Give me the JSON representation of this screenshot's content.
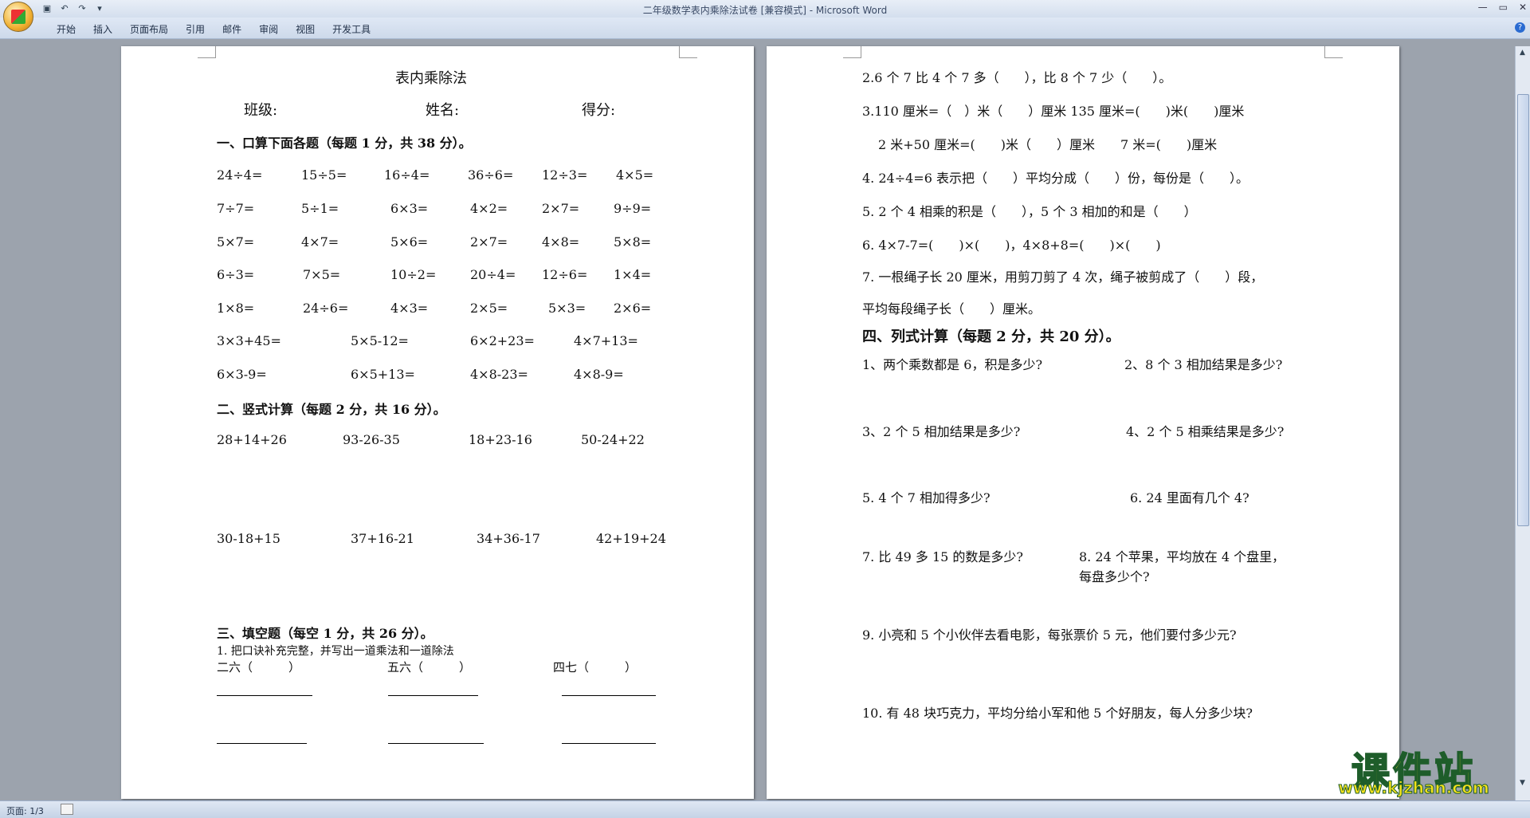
{
  "window": {
    "title": "二年级数学表内乘除法试卷 [兼容模式] - Microsoft Word",
    "tabs": [
      "开始",
      "插入",
      "页面布局",
      "引用",
      "邮件",
      "审阅",
      "视图",
      "开发工具"
    ]
  },
  "status": {
    "page": "页面: 1/3"
  },
  "watermark": {
    "brand": "课件站",
    "url": "www.kjzhan.com"
  },
  "page1": {
    "title": "表内乘除法",
    "class_label": "班级:",
    "name_label": "姓名:",
    "score_label": "得分:",
    "sec1": "一、口算下面各题（每题 1 分，共 38 分）。",
    "oral_rows": [
      [
        "24÷4=",
        "15÷5=",
        "16÷4=",
        "36÷6=",
        "12÷3=",
        "4×5="
      ],
      [
        "7÷7=",
        "5÷1=",
        "6×3=",
        "4×2=",
        "2×7=",
        "9÷9="
      ],
      [
        "5×7=",
        "4×7=",
        "5×6=",
        "2×7=",
        "4×8=",
        "5×8="
      ],
      [
        "6÷3=",
        "7×5=",
        "10÷2=",
        "20÷4=",
        "12÷6=",
        "1×4="
      ],
      [
        "1×8=",
        "24÷6=",
        "4×3=",
        "2×5=",
        "5×3=",
        "2×6="
      ]
    ],
    "mixed_rows": [
      [
        "3×3+45=",
        "5×5-12=",
        "6×2+23=",
        "4×7+13="
      ],
      [
        "6×3-9=",
        "6×5+13=",
        "4×8-23=",
        "4×8-9="
      ]
    ],
    "sec2": "二、竖式计算（每题 2 分，共 16 分）。",
    "vert_row1": [
      "28+14+26",
      "93-26-35",
      "18+23-16",
      "50-24+22"
    ],
    "vert_row2": [
      "30-18+15",
      "37+16-21",
      "34+36-17",
      "42+19+24"
    ],
    "sec3": "三、填空题（每空 1 分，共 26 分）。",
    "q1": "1. 把口诀补充完整，并写出一道乘法和一道除法",
    "koujue": [
      "二六（　　　）",
      "五六（　　　）",
      "四七（　　　）"
    ]
  },
  "page2": {
    "q2": "2.6 个 7 比 4 个 7 多（　　），比 8 个 7 少（　　）。",
    "q3a": "3.110 厘米=（　）米（　　）厘米 135 厘米=(　　)米(　　)厘米",
    "q3b": "2 米+50 厘米=(　　)米（　　）厘米　　7 米=(　　)厘米",
    "q4": "4.  24÷4=6 表示把（　　）平均分成（　　）份，每份是（　　）。",
    "q5": "5. 2 个 4 相乘的积是（　　），5 个 3 相加的和是（　　）",
    "q6": "6.  4×7-7=(　　)×(　　)，4×8+8=(　　)×(　　)",
    "q7a": "7. 一根绳子长 20 厘米，用剪刀剪了 4 次，绳子被剪成了（　　）段，",
    "q7b": "平均每段绳子长（　　）厘米。",
    "sec4": "四、列式计算（每题 2 分，共 20 分）。",
    "p1": "1、两个乘数都是 6，积是多少?",
    "p2": "2、8 个 3 相加结果是多少?",
    "p3": "3、2 个 5 相加结果是多少?",
    "p4": "4、2 个 5 相乘结果是多少?",
    "p5": "5. 4 个 7 相加得多少?",
    "p6": "6. 24 里面有几个 4?",
    "p7": "7. 比 49 多 15 的数是多少?",
    "p8a": "8. 24 个苹果，平均放在 4 个盘里，",
    "p8b": "每盘多少个?",
    "p9": "9.  小亮和 5 个小伙伴去看电影，每张票价 5 元，他们要付多少元?",
    "p10": "10. 有 48 块巧克力，平均分给小军和他 5 个好朋友，每人分多少块?"
  }
}
